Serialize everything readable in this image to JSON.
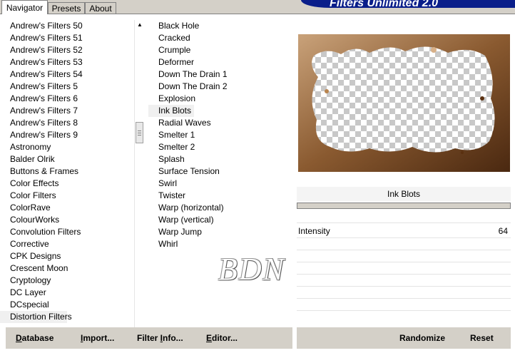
{
  "tabs": [
    {
      "label": "Navigator",
      "active": true
    },
    {
      "label": "Presets",
      "active": false
    },
    {
      "label": "About",
      "active": false
    }
  ],
  "banner": {
    "title": "Filters Unlimited 2.0"
  },
  "categories": [
    "Andrew's Filters 50",
    "Andrew's Filters 51",
    "Andrew's Filters 52",
    "Andrew's Filters 53",
    "Andrew's Filters 54",
    "Andrew's Filters 5",
    "Andrew's Filters 6",
    "Andrew's Filters 7",
    "Andrew's Filters 8",
    "Andrew's Filters 9",
    "Astronomy",
    "Balder Olrik",
    "Buttons & Frames",
    "Color Effects",
    "Color Filters",
    "ColorRave",
    "ColourWorks",
    "Convolution Filters",
    "Corrective",
    "CPK Designs",
    "Crescent Moon",
    "Cryptology",
    "DC Layer",
    "DCspecial",
    "Distortion Filters"
  ],
  "selected_category": "Distortion Filters",
  "filters": [
    "Black Hole",
    "Cracked",
    "Crumple",
    "Deformer",
    "Down The Drain 1",
    "Down The Drain 2",
    "Explosion",
    "Ink Blots",
    "Radial Waves",
    "Smelter 1",
    "Smelter 2",
    "Splash",
    "Surface Tension",
    "Swirl",
    "Twister",
    "Warp (horizontal)",
    "Warp (vertical)",
    "Warp Jump",
    "Whirl"
  ],
  "selected_filter": "Ink Blots",
  "filter_panel": {
    "title": "Ink Blots"
  },
  "parameters": [
    {
      "label": "Intensity",
      "value": "64"
    }
  ],
  "watermark": "BDN",
  "buttons": {
    "database": {
      "u": "D",
      "rest": "atabase"
    },
    "import": {
      "u": "I",
      "rest": "mport..."
    },
    "filter_info": {
      "pre": "Filter ",
      "u": "I",
      "rest": "nfo..."
    },
    "editor": {
      "u": "E",
      "rest": "ditor..."
    },
    "randomize": "Randomize",
    "reset": "Reset"
  },
  "icons": {
    "scroll_up": "arrow-up-icon",
    "scroll_down": "arrow-down-icon"
  }
}
